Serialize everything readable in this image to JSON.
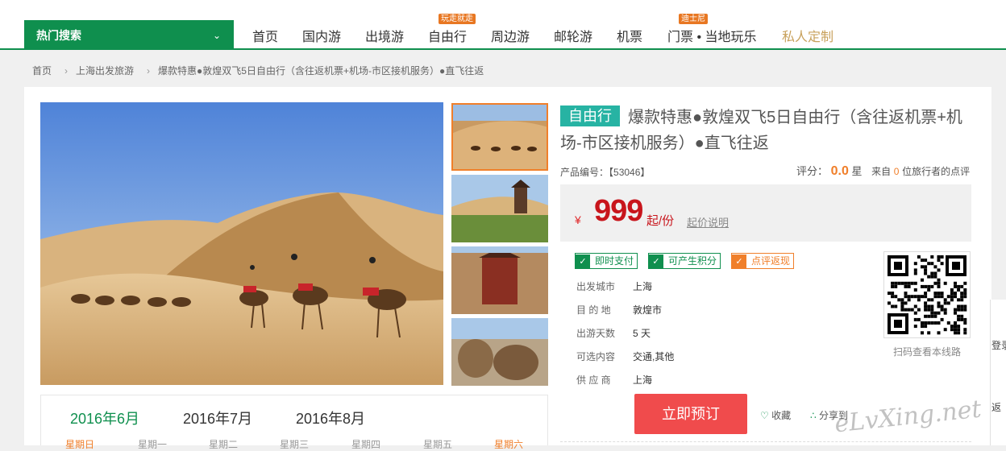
{
  "nav": {
    "hot_search": "热门搜索",
    "items": [
      "首页",
      "国内游",
      "出境游",
      "自由行",
      "周边游",
      "邮轮游",
      "机票",
      "门票 • 当地玩乐",
      "私人定制"
    ],
    "badges": {
      "free": "玩走就走",
      "disney": "迪士尼"
    }
  },
  "breadcrumb": [
    "首页",
    "上海出发旅游",
    "爆款特惠●敦煌双飞5日自由行（含往返机票+机场-市区接机服务）●直飞往返"
  ],
  "calendar": {
    "months": [
      "2016年6月",
      "2016年7月",
      "2016年8月"
    ],
    "weekdays": [
      "星期日",
      "星期一",
      "星期二",
      "星期三",
      "星期四",
      "星期五",
      "星期六"
    ]
  },
  "product": {
    "tag": "自由行",
    "title": "爆款特惠●敦煌双飞5日自由行（含往返机票+机场-市区接机服务）●直飞往返",
    "id_label": "产品编号：",
    "id_value": "【53046】",
    "rating_label": "评分：",
    "score": "0.0",
    "star_unit": "星",
    "review_prefix": "来自",
    "review_count": "0",
    "review_suffix": "位旅行者的点评",
    "currency": "¥",
    "price": "999",
    "price_unit": "起/份",
    "price_note": "起价说明",
    "badges": [
      "即时支付",
      "可产生积分",
      "点评返现"
    ],
    "info": [
      {
        "k": "出发城市",
        "v": "上海"
      },
      {
        "k": "目 的 地",
        "v": "敦煌市"
      },
      {
        "k": "出游天数",
        "v": "5 天"
      },
      {
        "k": "可选内容",
        "v": "交通,其他"
      },
      {
        "k": "供 应 商",
        "v": "上海"
      }
    ],
    "qr_caption": "扫码查看本线路",
    "book_button": "立即预订",
    "favorite": "收藏",
    "share": "分享到"
  },
  "watermark": "eLvXing.net",
  "side": {
    "login": "登录",
    "back": "返"
  },
  "colors": {
    "brand_green": "#0f8f4e",
    "price_red": "#c8151c",
    "accent_orange": "#f07f2a",
    "tag_teal": "#27b3a3"
  }
}
